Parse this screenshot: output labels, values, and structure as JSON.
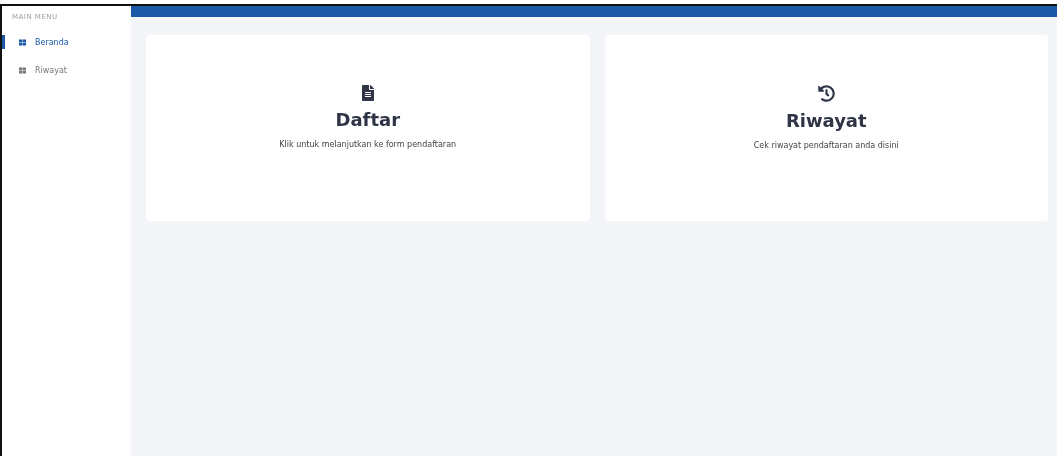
{
  "sidebar": {
    "heading": "MAIN MENU",
    "items": [
      {
        "label": "Beranda",
        "selected": true
      },
      {
        "label": "Riwayat",
        "selected": false
      }
    ]
  },
  "cards": [
    {
      "kind": "file",
      "title": "Daftar",
      "description": "Klik untuk melanjutkan ke form pendaftaran"
    },
    {
      "kind": "history",
      "title": "Riwayat",
      "description": "Cek riwayat pendaftaran anda disini"
    }
  ]
}
